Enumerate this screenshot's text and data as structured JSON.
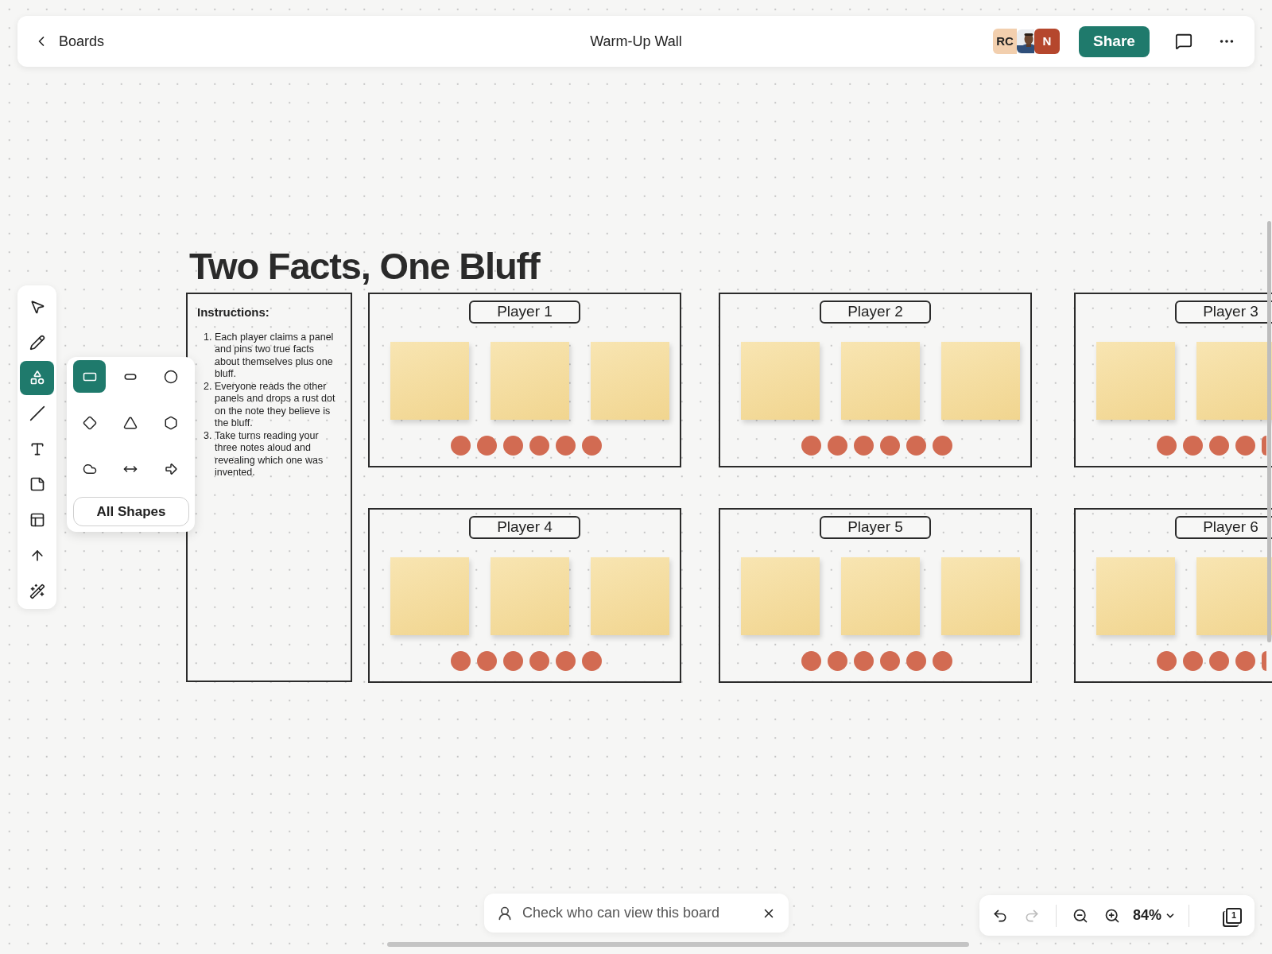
{
  "header": {
    "back_label": "Boards",
    "title": "Warm-Up Wall",
    "share": "Share",
    "avatars": [
      {
        "kind": "initials",
        "initials": "RC",
        "color": "#f2cfae"
      },
      {
        "kind": "picture"
      },
      {
        "kind": "initials",
        "initials": "N",
        "color": "#b5472d"
      }
    ]
  },
  "toolbar": {
    "tools": [
      {
        "kind": "select",
        "selected": false
      },
      {
        "kind": "pen",
        "selected": false
      },
      {
        "kind": "shapes",
        "selected": true
      },
      {
        "kind": "line",
        "selected": false
      },
      {
        "kind": "text",
        "selected": false
      },
      {
        "kind": "sticky",
        "selected": false
      },
      {
        "kind": "layout",
        "selected": false
      },
      {
        "kind": "arrow",
        "selected": false
      },
      {
        "kind": "magic",
        "selected": false
      }
    ]
  },
  "shapes_popup": {
    "shapes": [
      {
        "kind": "rectangle",
        "selected": true
      },
      {
        "kind": "rounded",
        "selected": false
      },
      {
        "kind": "circle",
        "selected": false
      },
      {
        "kind": "diamond",
        "selected": false
      },
      {
        "kind": "triangle",
        "selected": false
      },
      {
        "kind": "hexagon",
        "selected": false
      },
      {
        "kind": "cloud",
        "selected": false
      },
      {
        "kind": "double_arrow",
        "selected": false
      },
      {
        "kind": "block_arrow",
        "selected": false
      }
    ],
    "all_label": "All Shapes"
  },
  "board": {
    "title": "Two Facts, One Bluff",
    "instructions": {
      "heading": "Instructions:",
      "steps": [
        {
          "number": "1.",
          "text": "Each player claims a panel and pins two true facts about themselves plus one bluff."
        },
        {
          "number": "2.",
          "text": "Everyone reads the other panels and drops a rust dot on the note they believe is the bluff."
        },
        {
          "number": "3.",
          "text": "Take turns reading your three notes aloud and revealing which one was invented."
        }
      ]
    },
    "panels": [
      {
        "label": "Player 1"
      },
      {
        "label": "Player 2"
      },
      {
        "label": "Player 3"
      },
      {
        "label": "Player 4"
      },
      {
        "label": "Player 5"
      },
      {
        "label": "Player 6"
      }
    ]
  },
  "notice": {
    "text": "Check who can view this board"
  },
  "zoom": {
    "undo_disabled": false,
    "redo_disabled": true,
    "level_label": "84%",
    "page_label": "1"
  }
}
